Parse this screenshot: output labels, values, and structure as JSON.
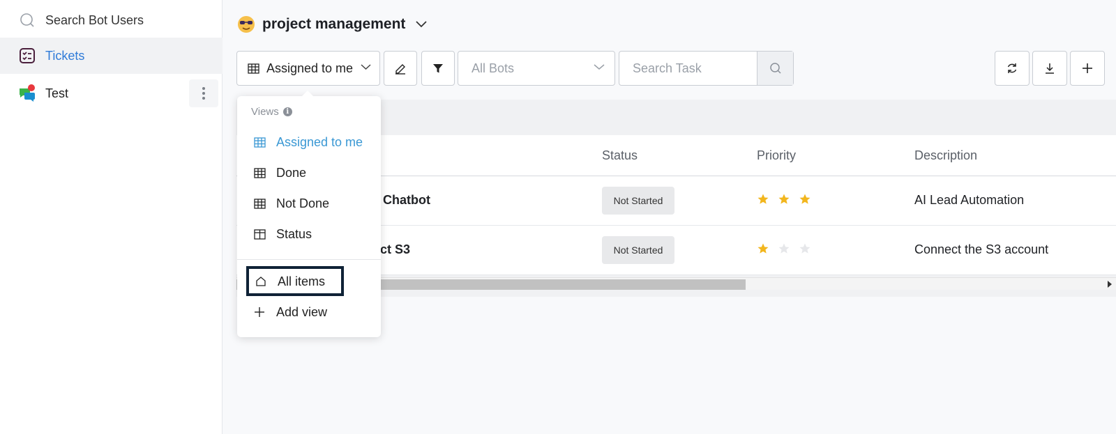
{
  "sidebar": {
    "search_label": "Search Bot Users",
    "items": [
      {
        "label": "Tickets",
        "active": true
      },
      {
        "label": "Test",
        "active": false
      }
    ]
  },
  "header": {
    "project_title": "project management"
  },
  "toolbar": {
    "view_label": "Assigned to me",
    "bots_placeholder": "All Bots",
    "search_placeholder": "Search Task"
  },
  "table": {
    "columns": [
      "Status",
      "Priority",
      "Description"
    ],
    "rows": [
      {
        "name": "Chatbot",
        "status": "Not Started",
        "priority": 3,
        "description": "AI Lead Automation"
      },
      {
        "name": "ct S3",
        "status": "Not Started",
        "priority": 1,
        "description": "Connect the S3 account"
      }
    ]
  },
  "dropdown": {
    "header": "Views",
    "views": [
      "Assigned to me",
      "Done",
      "Not Done",
      "Status"
    ],
    "all_items": "All items",
    "add_view": "Add view"
  },
  "colors": {
    "accent": "#2f7bd8",
    "selected_view": "#3a98d4",
    "star_filled": "#f2b61d",
    "star_empty": "#e6e7ea"
  }
}
